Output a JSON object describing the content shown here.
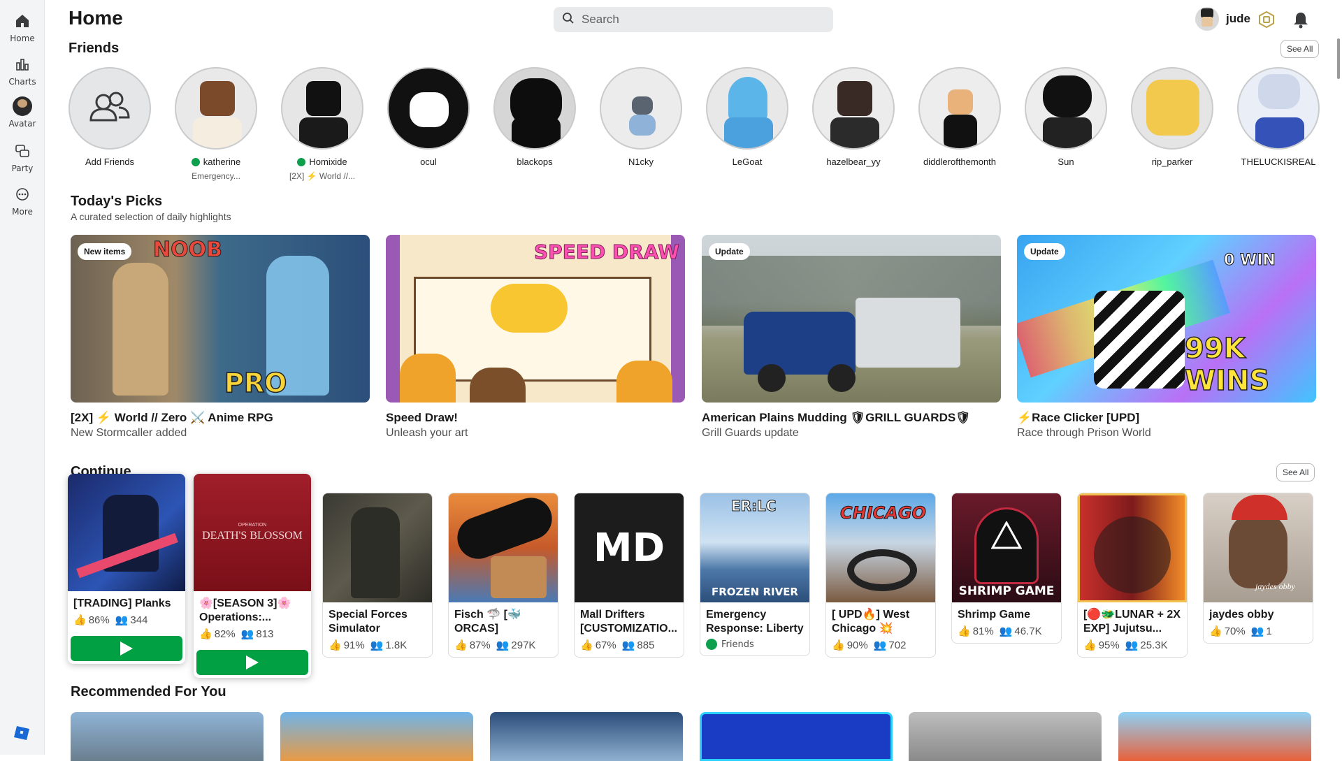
{
  "sidebar": {
    "items": [
      {
        "label": "Home",
        "icon": "home-icon"
      },
      {
        "label": "Charts",
        "icon": "charts-icon"
      },
      {
        "label": "Avatar",
        "icon": "avatar-icon"
      },
      {
        "label": "Party",
        "icon": "party-icon"
      },
      {
        "label": "More",
        "icon": "more-icon"
      }
    ]
  },
  "header": {
    "title": "Home",
    "search_placeholder": "Search",
    "username": "jude"
  },
  "friends": {
    "title": "Friends",
    "see_all": "See All",
    "items": [
      {
        "name": "Add Friends",
        "sub": "",
        "online": false
      },
      {
        "name": "katherine",
        "sub": "Emergency...",
        "online": true
      },
      {
        "name": "Homixide",
        "sub": "[2X] ⚡ World //...",
        "online": true
      },
      {
        "name": "ocul",
        "sub": "",
        "online": false
      },
      {
        "name": "blackops",
        "sub": "",
        "online": false
      },
      {
        "name": "N1cky",
        "sub": "",
        "online": false
      },
      {
        "name": "LeGoat",
        "sub": "",
        "online": false
      },
      {
        "name": "hazelbear_yy",
        "sub": "",
        "online": false
      },
      {
        "name": "diddlerofthemonth",
        "sub": "",
        "online": false
      },
      {
        "name": "Sun",
        "sub": "",
        "online": false
      },
      {
        "name": "rip_parker",
        "sub": "",
        "online": false
      },
      {
        "name": "THELUCKISREAL",
        "sub": "",
        "online": false
      }
    ]
  },
  "picks": {
    "title": "Today's Picks",
    "subtitle": "A curated selection of daily highlights",
    "items": [
      {
        "badge": "New items",
        "name": "[2X] ⚡ World // Zero ⚔️ Anime RPG",
        "sub": "New Stormcaller added",
        "overlay1": "NOOB",
        "overlay2": "PRO"
      },
      {
        "badge": "",
        "name": "Speed Draw!",
        "sub": "Unleash your art",
        "overlay1": "SPEED DRAW",
        "overlay2": ""
      },
      {
        "badge": "Update",
        "name": "American Plains Mudding 🛡GRILL GUARDS🛡",
        "sub": "Grill Guards update",
        "overlay1": "",
        "overlay2": ""
      },
      {
        "badge": "Update",
        "name": "⚡Race Clicker [UPD]",
        "sub": "Race through Prison World",
        "overlay1": "0 WIN",
        "overlay2": "99K WINS"
      }
    ]
  },
  "continue": {
    "title": "Continue",
    "see_all": "See All",
    "items": [
      {
        "name": "[TRADING] Planks",
        "rating": "86%",
        "players": "344",
        "thumb_text": ""
      },
      {
        "name": "🌸[SEASON 3]🌸Operations:...",
        "rating": "82%",
        "players": "813",
        "thumb_text": "DEATH'S BLOSSOM",
        "thumb_small": "OPERATION"
      },
      {
        "name": "Special Forces Simulator",
        "rating": "91%",
        "players": "1.8K",
        "thumb_text": ""
      },
      {
        "name": "Fisch 🦈 [🐳 ORCAS]",
        "rating": "87%",
        "players": "297K",
        "thumb_text": ""
      },
      {
        "name": "Mall Drifters [CUSTOMIZATIO...",
        "rating": "67%",
        "players": "885",
        "thumb_text": "MD"
      },
      {
        "name": "Emergency Response: Liberty",
        "rating": "",
        "players": "",
        "friends": "Friends",
        "thumb_text": "FROZEN RIVER",
        "thumb_top": "ER:LC"
      },
      {
        "name": "[ UPD🔥] West Chicago 💥",
        "rating": "90%",
        "players": "702",
        "thumb_text": "CHICAGO"
      },
      {
        "name": "Shrimp Game",
        "rating": "81%",
        "players": "46.7K",
        "thumb_text": "SHRIMP GAME"
      },
      {
        "name": "[🔴🐲LUNAR + 2X EXP] Jujutsu...",
        "rating": "95%",
        "players": "25.3K",
        "thumb_text": ""
      },
      {
        "name": "jaydes obby",
        "rating": "70%",
        "players": "1",
        "thumb_text": "jaydes obby"
      }
    ]
  },
  "recommended": {
    "title": "Recommended For You"
  },
  "colors": {
    "play_green": "#00a043",
    "online_green": "#0d9f4c"
  }
}
